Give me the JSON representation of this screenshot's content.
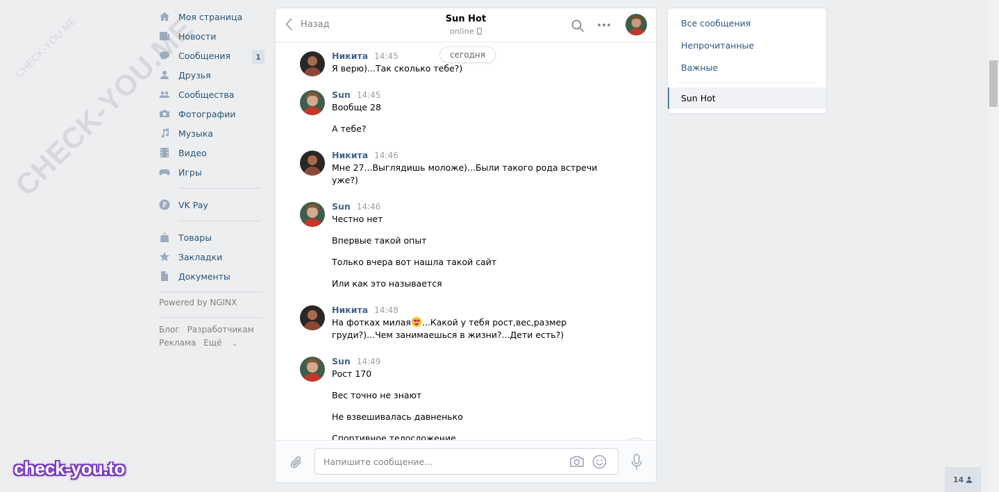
{
  "watermarks": {
    "diagonal": "CHECK-YOU.ME",
    "small": "CHECK-YOU.ME",
    "brand": "check-you.to"
  },
  "nav": {
    "items": [
      {
        "label": "Моя страница",
        "icon": "home-icon"
      },
      {
        "label": "Новости",
        "icon": "news-icon"
      },
      {
        "label": "Сообщения",
        "icon": "messages-icon",
        "badge": "1"
      },
      {
        "label": "Друзья",
        "icon": "friends-icon"
      },
      {
        "label": "Сообщества",
        "icon": "groups-icon"
      },
      {
        "label": "Фотографии",
        "icon": "camera-icon"
      },
      {
        "label": "Музыка",
        "icon": "music-icon"
      },
      {
        "label": "Видео",
        "icon": "video-icon"
      },
      {
        "label": "Игры",
        "icon": "gamepad-icon"
      }
    ],
    "pay": {
      "label": "VK Pay",
      "icon": "vkpay-icon"
    },
    "extra": [
      {
        "label": "Товары",
        "icon": "bag-icon"
      },
      {
        "label": "Закладки",
        "icon": "star-icon"
      },
      {
        "label": "Документы",
        "icon": "document-icon"
      }
    ],
    "powered": "Powered by NGINX",
    "footer": {
      "blog": "Блог",
      "developers": "Разработчикам",
      "ads": "Реклама",
      "more": "Ещё"
    }
  },
  "chat": {
    "back_label": "Назад",
    "peer_name": "Sun Hot",
    "peer_status": "online",
    "date_pill": "сегодня",
    "messages": [
      {
        "author": "Никита",
        "time": "14:45",
        "lines": [
          "Я верю)...Так сколько тебе?)"
        ]
      },
      {
        "author": "Sun",
        "time": "14:45",
        "lines": [
          "Вообще 28",
          "А тебе?"
        ]
      },
      {
        "author": "Никита",
        "time": "14:46",
        "lines": [
          "Мне 27...Выглядишь моложе)...Были такого рода встречи",
          "уже?)"
        ]
      },
      {
        "author": "Sun",
        "time": "14:46",
        "lines": [
          "Честно нет",
          "Впервые такой опыт",
          "Только вчера вот нашла такой сайт",
          "Или как это называется"
        ]
      },
      {
        "author": "Никита",
        "time": "14:48",
        "lines": [
          "На фотках милая",
          "...Какой у тебя рост,вес,размер",
          "груди?)...Чем занимаешься в жизни?...Дети есть?)"
        ]
      },
      {
        "author": "Sun",
        "time": "14:49",
        "lines": [
          "Рост 170",
          "Вес точно не знают",
          "Не взвешивалась давненько",
          "Спортивное телосложение"
        ]
      }
    ],
    "composer_placeholder": "Напишите сообщение..."
  },
  "filters": {
    "all": "Все сообщения",
    "unread": "Непрочитанные",
    "important": "Важные",
    "active": "Sun Hot"
  },
  "online_count": "14",
  "colors": {
    "background": "#edeef0",
    "link": "#2a5885",
    "author": "#42648b",
    "icon": "#9aabbe"
  }
}
